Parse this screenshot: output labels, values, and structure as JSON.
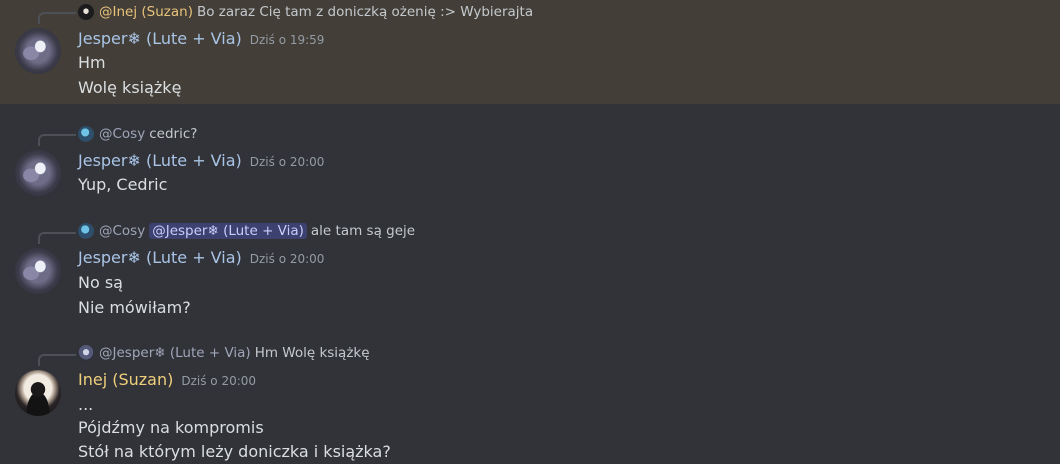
{
  "messages": [
    {
      "reply": {
        "name": "@Inej (Suzan)",
        "text": "Bo zaraz Cię tam z doniczką ożenię :> Wybierajta"
      },
      "author": "Jesper❄ (Lute + Via)",
      "timestamp": "Dziś o 19:59",
      "lines": [
        "Hm",
        "Wolę książkę"
      ]
    },
    {
      "reply": {
        "name": "@Cosy",
        "text": "cedric?"
      },
      "author": "Jesper❄ (Lute + Via)",
      "timestamp": "Dziś o 20:00",
      "lines": [
        "Yup, Cedric"
      ]
    },
    {
      "reply": {
        "name": "@Cosy",
        "mention": "@Jesper❄ (Lute + Via)",
        "text": "ale tam są geje"
      },
      "author": "Jesper❄ (Lute + Via)",
      "timestamp": "Dziś o 20:00",
      "lines": [
        "No są",
        "Nie mówiłam?"
      ]
    },
    {
      "reply": {
        "name": "@Jesper❄ (Lute + Via)",
        "text": "Hm Wolę książkę"
      },
      "author": "Inej (Suzan)",
      "timestamp": "Dziś o 20:00",
      "lines": [
        "...",
        "Pójdźmy na kompromis",
        "Stół na którym leży doniczka i książka?"
      ]
    }
  ],
  "colors": {
    "background": "#313338",
    "highlight": "#433f38",
    "jesper_name": "#a9c4e6",
    "inej_name": "#f0cf7c",
    "mention_bg": "#3d4270"
  }
}
